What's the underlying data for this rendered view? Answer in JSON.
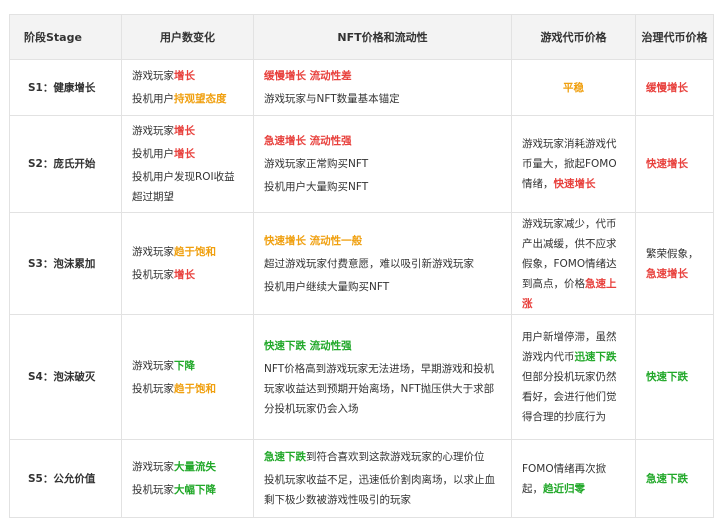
{
  "headers": [
    "阶段Stage",
    "用户数变化",
    "NFT价格和流动性",
    "游戏代币价格",
    "治理代币价格"
  ],
  "rows": [
    {
      "stage": "S1：健康增长",
      "users": [
        [
          {
            "t": "游戏玩家",
            "c": ""
          },
          {
            "t": "增长",
            "c": "r"
          }
        ],
        [
          {
            "t": "投机用户",
            "c": ""
          },
          {
            "t": "持观望态度",
            "c": "o"
          }
        ]
      ],
      "nft": [
        [
          {
            "t": "缓慢增长 流动性差",
            "c": "r"
          }
        ],
        [
          {
            "t": "游戏玩家与NFT数量基本锚定",
            "c": ""
          }
        ]
      ],
      "game_token": [
        {
          "t": "平稳",
          "c": "o"
        }
      ],
      "gov_token": [
        {
          "t": "缓慢增长",
          "c": "r"
        }
      ]
    },
    {
      "stage": "S2：庞氏开始",
      "users": [
        [
          {
            "t": "游戏玩家",
            "c": ""
          },
          {
            "t": "增长",
            "c": "r"
          }
        ],
        [
          {
            "t": "投机用户",
            "c": ""
          },
          {
            "t": "增长",
            "c": "r"
          }
        ],
        [
          {
            "t": "投机用户发现ROI收益超过期望",
            "c": ""
          }
        ]
      ],
      "nft": [
        [
          {
            "t": "急速增长 流动性强",
            "c": "r"
          }
        ],
        [
          {
            "t": "游戏玩家正常购买NFT",
            "c": ""
          }
        ],
        [
          {
            "t": "投机用户大量购买NFT",
            "c": ""
          }
        ]
      ],
      "game_token": [
        {
          "t": "游戏玩家消耗游戏代币量大，掀起FOMO情绪，",
          "c": ""
        },
        {
          "t": "快速增长",
          "c": "r"
        }
      ],
      "gov_token": [
        {
          "t": "快速增长",
          "c": "r"
        }
      ]
    },
    {
      "stage": "S3：泡沫累加",
      "users": [
        [
          {
            "t": "游戏玩家",
            "c": ""
          },
          {
            "t": "趋于饱和",
            "c": "o"
          }
        ],
        [
          {
            "t": "投机玩家",
            "c": ""
          },
          {
            "t": "增长",
            "c": "r"
          }
        ]
      ],
      "nft": [
        [
          {
            "t": "快速增长 流动性一般",
            "c": "o"
          }
        ],
        [
          {
            "t": "超过游戏玩家付费意愿，难以吸引新游戏玩家",
            "c": ""
          }
        ],
        [
          {
            "t": "投机用户继续大量购买NFT",
            "c": ""
          }
        ]
      ],
      "game_token": [
        {
          "t": "游戏玩家减少，代币产出减缓，供不应求假象，FOMO情绪达到高点，价格",
          "c": ""
        },
        {
          "t": "急速上涨",
          "c": "r"
        }
      ],
      "gov_token": [
        {
          "t": "繁荣假象，",
          "c": ""
        },
        {
          "t": "急速增长",
          "c": "r"
        }
      ]
    },
    {
      "stage": "S4：泡沫破灭",
      "users": [
        [
          {
            "t": "游戏玩家",
            "c": ""
          },
          {
            "t": "下降",
            "c": "g"
          }
        ],
        [
          {
            "t": "投机玩家",
            "c": ""
          },
          {
            "t": "趋于饱和",
            "c": "o"
          }
        ]
      ],
      "nft": [
        [
          {
            "t": "快速下跌 流动性强",
            "c": "g"
          }
        ],
        [
          {
            "t": "NFT价格高到游戏玩家无法进场，早期游戏和投机玩家收益达到预期开始离场，NFT抛压供大于求部分投机玩家仍会入场",
            "c": ""
          }
        ]
      ],
      "game_token": [
        {
          "t": "用户新增停滞，虽然游戏内代币",
          "c": ""
        },
        {
          "t": "迅速下跌",
          "c": "g"
        },
        {
          "t": "但部分投机玩家仍然看好，会进行他们觉得合理的抄底行为",
          "c": ""
        }
      ],
      "gov_token": [
        {
          "t": "快速下跌",
          "c": "g"
        }
      ]
    },
    {
      "stage": "S5：公允价值",
      "users": [
        [
          {
            "t": "游戏玩家",
            "c": ""
          },
          {
            "t": "大量流失",
            "c": "g"
          }
        ],
        [
          {
            "t": "投机玩家",
            "c": ""
          },
          {
            "t": "大幅下降",
            "c": "g"
          }
        ]
      ],
      "nft": [
        [
          {
            "t": "急速下跌",
            "c": "g"
          },
          {
            "t": "到符合喜欢到这款游戏玩家的心理价位",
            "c": ""
          }
        ],
        [
          {
            "t": "投机玩家收益不足，迅速低价割肉离场，以求止血剩下极少数被游戏性吸引的玩家",
            "c": ""
          }
        ]
      ],
      "game_token": [
        {
          "t": "FOMO情绪再次掀起，",
          "c": ""
        },
        {
          "t": "趋近归零",
          "c": "g"
        }
      ],
      "gov_token": [
        {
          "t": "急速下跌",
          "c": "g"
        }
      ]
    }
  ]
}
